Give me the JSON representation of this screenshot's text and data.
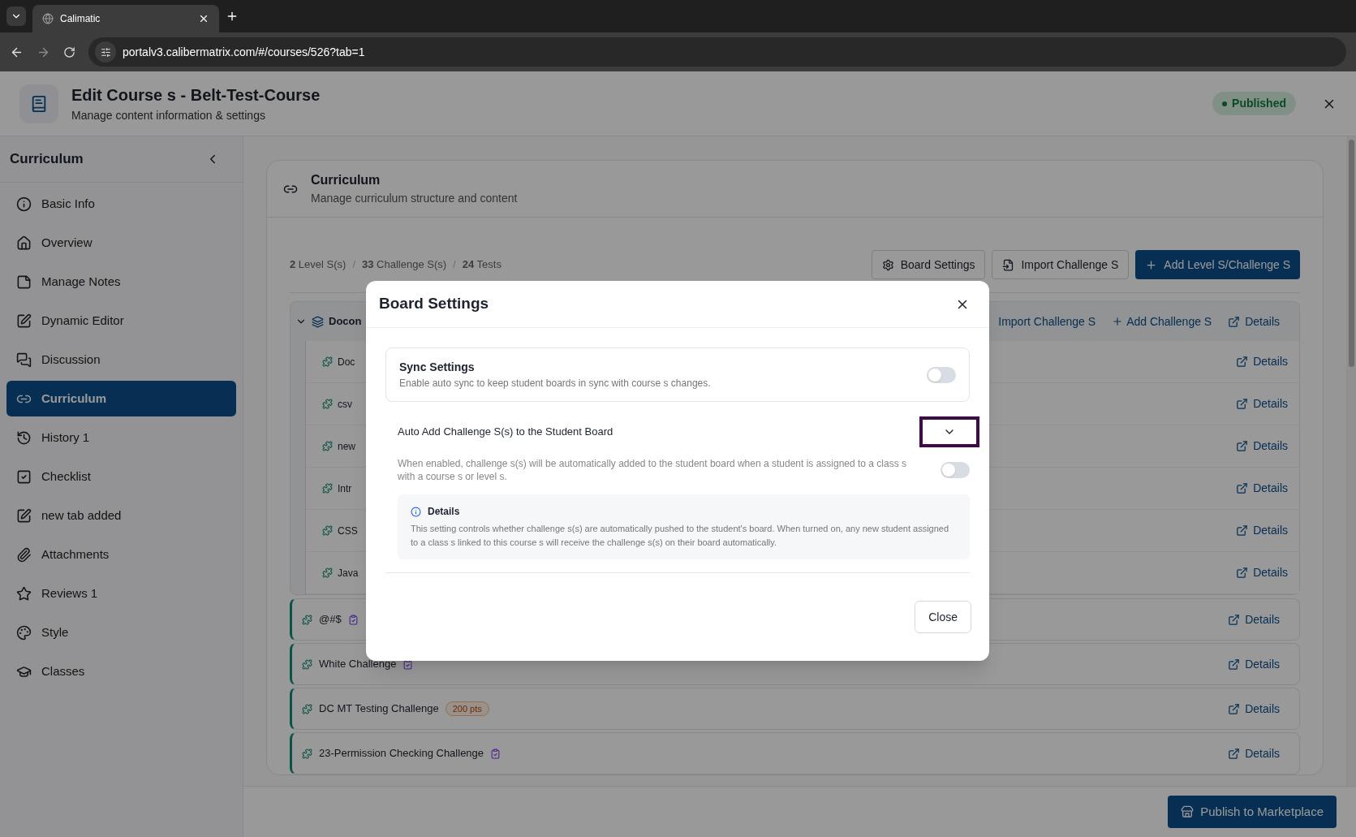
{
  "browser": {
    "tab_title": "Calimatic",
    "url": "portalv3.calibermatrix.com/#/courses/526?tab=1"
  },
  "header": {
    "title": "Edit Course s - Belt-Test-Course",
    "subtitle": "Manage content information & settings",
    "status": "Published"
  },
  "sidebar": {
    "title": "Curriculum",
    "items": [
      {
        "label": "Basic Info",
        "selected": false
      },
      {
        "label": "Overview",
        "selected": false
      },
      {
        "label": "Manage Notes",
        "selected": false
      },
      {
        "label": "Dynamic Editor",
        "selected": false
      },
      {
        "label": "Discussion",
        "selected": false
      },
      {
        "label": "Curriculum",
        "selected": true
      },
      {
        "label": "History 1",
        "selected": false
      },
      {
        "label": "Checklist",
        "selected": false
      },
      {
        "label": "new tab added",
        "selected": false
      },
      {
        "label": "Attachments",
        "selected": false
      },
      {
        "label": "Reviews 1",
        "selected": false
      },
      {
        "label": "Style",
        "selected": false
      },
      {
        "label": "Classes",
        "selected": false
      }
    ]
  },
  "curriculum": {
    "title": "Curriculum",
    "subtitle": "Manage curriculum structure and content",
    "stats": [
      "**2** Level S(s)",
      "**33** Challenge S(s)",
      "**24** Tests"
    ],
    "stats_separator": "/",
    "buttons": [
      {
        "kind": "settings",
        "label": "Board Settings"
      },
      {
        "kind": "import",
        "label": "Import Challenge S"
      },
      {
        "kind": "add",
        "label": "Add Level S/Challenge S"
      }
    ],
    "level": {
      "name": "Docon",
      "expanded": true,
      "actions": [
        "Import Challenge S",
        "Add Challenge S",
        "Details"
      ],
      "children": [
        {
          "name": "Doc",
          "details": "Details"
        },
        {
          "name": "csv",
          "details": "Details"
        },
        {
          "name": "new",
          "details": "Details"
        },
        {
          "name": "Intr",
          "details": "Details"
        },
        {
          "name": "CSS",
          "details": "Details"
        },
        {
          "name": "Java",
          "details": "Details"
        }
      ]
    },
    "challenges": [
      {
        "name": "@#$",
        "task": true,
        "details": "Details"
      },
      {
        "name": "White Challenge",
        "task": true,
        "details": "Details"
      },
      {
        "name": "DC MT Testing Challenge",
        "task": false,
        "points": "200 pts",
        "details": "Details"
      },
      {
        "name": "23-Permission Checking Challenge",
        "task": true,
        "details": "Details"
      }
    ]
  },
  "footer": {
    "button": "Publish to Marketplace"
  },
  "dialog": {
    "title": "Board Settings",
    "sync": {
      "title": "Sync Settings",
      "description": "Enable auto sync to keep student boards in sync with course s changes.",
      "on": false
    },
    "auto_add": {
      "title": "Auto Add Challenge S(s) to the Student Board",
      "expanded": true,
      "description": "When enabled, challenge s(s) will be automatically added to the student board when a student is assigned to a class s with a course s or level s.",
      "on": false
    },
    "details": {
      "title": "Details",
      "text": "This setting controls whether challenge s(s) are automatically pushed to the student's board. When turned on, any new student assigned to a class s linked to this course s will receive the challenge s(s) on their board automatically."
    },
    "close": "Close"
  }
}
